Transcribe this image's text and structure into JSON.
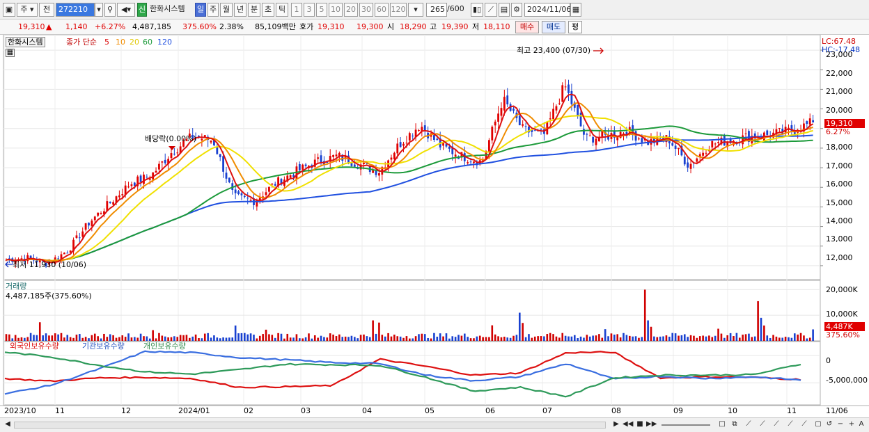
{
  "toolbar": {
    "market": "주",
    "prev_label": "전",
    "stock_code": "272210",
    "credit_badge": "신",
    "stock_name": "한화시스템",
    "periods": [
      "일",
      "주",
      "월",
      "년",
      "분",
      "초",
      "틱"
    ],
    "active_period": "일",
    "intervals": [
      "1",
      "3",
      "5",
      "10",
      "20",
      "30",
      "60",
      "120"
    ],
    "count": "265",
    "count_max": "/600",
    "date": "2024/11/06"
  },
  "quote": {
    "price": "19,310",
    "change_arrow": "▲",
    "change": "1,140",
    "change_pct": "+6.27%",
    "volume": "4,487,185",
    "volume_ratio": "375.60%",
    "turnover": "2.38%",
    "amount": "85,109백만",
    "ask_label": "호가",
    "ask1": "19,310",
    "ask2": "19,300",
    "open_label": "시",
    "open": "18,290",
    "high_label": "고",
    "high": "19,390",
    "low_label": "저",
    "low": "18,110",
    "buy_button": "매수",
    "sell_button": "매도",
    "eval_button": "평"
  },
  "price_panel": {
    "legend_name": "한화시스템",
    "legend_ma": "종가 단순",
    "ma_periods": [
      "5",
      "10",
      "20",
      "60",
      "120"
    ],
    "ma_colors": [
      "#dd1010",
      "#f08c00",
      "#f0e000",
      "#1c9a3a",
      "#2050e0"
    ],
    "lc": "LC:67.48",
    "hc": "HC:-17.48",
    "high_marker": "최고 23,400 (07/30)",
    "low_marker": "최저 11,930 (10/06)",
    "dividend_marker": "배당락(0.00%)",
    "last_price_tag": "19,310",
    "last_change_tag": "6.27%",
    "y_ticks": [
      "23,000",
      "22,000",
      "21,000",
      "20,000",
      "19,000",
      "18,000",
      "17,000",
      "16,000",
      "15,000",
      "14,000",
      "13,000",
      "12,000"
    ]
  },
  "volume_panel": {
    "title": "거래량",
    "subtitle": "4,487,185주(375.60%)",
    "y_ticks": [
      "20,000K",
      "10,000K"
    ],
    "last_tag": "4,487K",
    "last_pct": "375.60%"
  },
  "holdings_panel": {
    "series_labels": [
      "외국인보유수량",
      "기관보유수량",
      "개인보유수량"
    ],
    "series_colors": [
      "#dd1010",
      "#3a6ee0",
      "#2e9a5a"
    ],
    "y_ticks": [
      "0",
      "-5,000,000"
    ]
  },
  "x_axis": [
    "2023/10",
    "11",
    "12",
    "2024/01",
    "02",
    "03",
    "04",
    "05",
    "06",
    "07",
    "08",
    "09",
    "10",
    "11",
    "11/06"
  ],
  "chart_data": {
    "type": "line",
    "title": "",
    "price_range": [
      11500,
      23500
    ],
    "x_months": [
      "2023/10",
      "11",
      "12",
      "2024/01",
      "02",
      "03",
      "04",
      "05",
      "06",
      "07",
      "08",
      "09",
      "10",
      "11"
    ],
    "close_approx": [
      12300,
      12400,
      12100,
      12800,
      14200,
      15200,
      16200,
      16600,
      17800,
      18600,
      18400,
      15500,
      15300,
      16200,
      16800,
      17300,
      17600,
      17200,
      16800,
      18200,
      19200,
      18100,
      17600,
      17300,
      20500,
      18900,
      18700,
      21200,
      18500,
      18600,
      18900,
      18300,
      18500,
      17100,
      18200,
      18400,
      18600,
      18700,
      18900,
      19310
    ],
    "series": [
      {
        "name": "5",
        "color": "#dd1010"
      },
      {
        "name": "10",
        "color": "#f08c00"
      },
      {
        "name": "20",
        "color": "#f0e000"
      },
      {
        "name": "60",
        "color": "#1c9a3a"
      },
      {
        "name": "120",
        "color": "#2050e0"
      }
    ],
    "holdings_series": [
      {
        "name": "외국인보유수량",
        "values": [
          -4200000,
          -4700000,
          -4100000,
          -4000000,
          -4200000,
          -5800000,
          -5700000,
          -5500000,
          -700000,
          -2000000,
          -3600000,
          -3200000,
          500000,
          600000,
          -4100000,
          -3900000,
          -4000000,
          -4400000
        ]
      },
      {
        "name": "기관보유수량",
        "values": [
          -7000000,
          -5400000,
          -2500000,
          700000,
          500000,
          -400000,
          -800000,
          -1300000,
          -1500000,
          -3600000,
          -4600000,
          -3900000,
          -1500000,
          -4300000,
          -3800000,
          -4200000,
          -3900000,
          -4500000
        ]
      },
      {
        "name": "개인보유수량",
        "values": [
          600000,
          -300000,
          -1800000,
          -3000000,
          -3400000,
          -2600000,
          -1600000,
          -1700000,
          -1800000,
          -4000000,
          -6500000,
          -5800000,
          -7500000,
          -4100000,
          -3600000,
          -3600000,
          -3500000,
          -1600000
        ]
      }
    ]
  }
}
